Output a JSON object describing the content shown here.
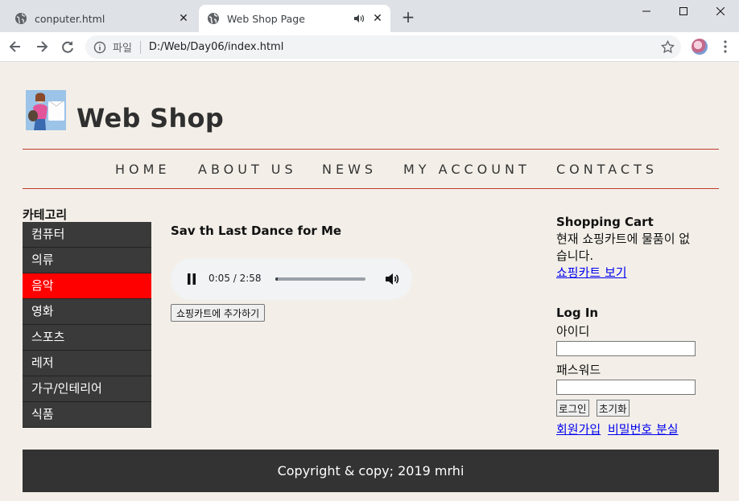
{
  "browser": {
    "tabs": [
      {
        "title": "conputer.html"
      },
      {
        "title": "Web Shop Page"
      }
    ],
    "address": {
      "scheme_label": "파일",
      "url": "D:/Web/Day06/index.html"
    }
  },
  "header": {
    "title": "Web Shop"
  },
  "nav": {
    "items": [
      "HOME",
      "ABOUT US",
      "NEWS",
      "MY ACCOUNT",
      "CONTACTS"
    ]
  },
  "sidebar": {
    "title": "카테고리",
    "items": [
      {
        "label": "컴퓨터",
        "active": false
      },
      {
        "label": "의류",
        "active": false
      },
      {
        "label": "음악",
        "active": true
      },
      {
        "label": "영화",
        "active": false
      },
      {
        "label": "스포츠",
        "active": false
      },
      {
        "label": "레저",
        "active": false
      },
      {
        "label": "가구/인테리어",
        "active": false
      },
      {
        "label": "식품",
        "active": false
      }
    ]
  },
  "main": {
    "song_title": "Sav th Last Dance for Me",
    "player": {
      "current": "0:05",
      "duration": "2:58",
      "time_display": "0:05 / 2:58",
      "progress": 0.03
    },
    "add_to_cart_label": "쇼핑카트에 추가하기"
  },
  "cart": {
    "title": "Shopping Cart",
    "empty_text": "현재 쇼핑카트에 물품이 없습니다.",
    "view_link": "쇼핑카트 보기"
  },
  "login": {
    "title": "Log In",
    "id_label": "아이디",
    "pw_label": "패스워드",
    "login_button": "로그인",
    "reset_button": "초기화",
    "signup_link": "회원가입",
    "forgot_link": "비밀번호 분실"
  },
  "footer": {
    "text": "Copyright & copy; 2019 mrhi"
  },
  "colors": {
    "accent_red": "#ff0000",
    "nav_line": "#c0392b",
    "footer_bg": "#333333",
    "page_bg": "#f3efe8"
  }
}
